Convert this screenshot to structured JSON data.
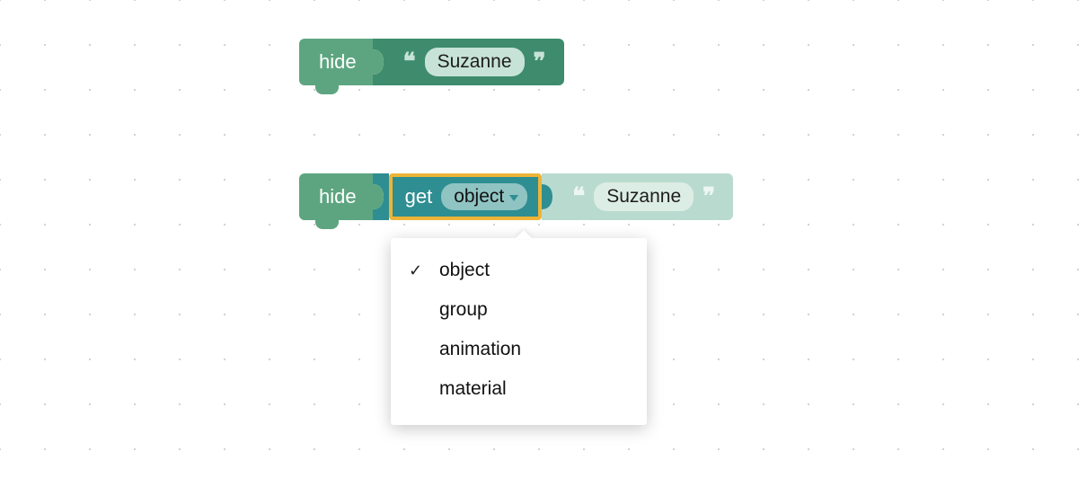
{
  "block1": {
    "hide_label": "hide",
    "text_value": "Suzanne"
  },
  "block2": {
    "hide_label": "hide",
    "get_label": "get",
    "dropdown_selected": "object",
    "text_value": "Suzanne"
  },
  "menu": {
    "items": [
      {
        "label": "object",
        "checked": true
      },
      {
        "label": "group",
        "checked": false
      },
      {
        "label": "animation",
        "checked": false
      },
      {
        "label": "material",
        "checked": false
      }
    ]
  }
}
